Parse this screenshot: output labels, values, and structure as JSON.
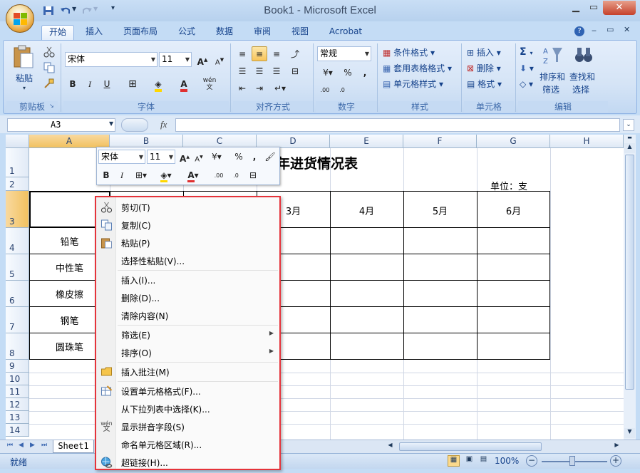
{
  "window": {
    "title": "Book1 - Microsoft Excel"
  },
  "tabs": [
    "开始",
    "插入",
    "页面布局",
    "公式",
    "数据",
    "审阅",
    "视图",
    "Acrobat"
  ],
  "ribbon": {
    "clipboard": {
      "paste": "粘贴",
      "label": "剪贴板"
    },
    "font": {
      "name": "宋体",
      "size": "11",
      "label": "字体",
      "bold": "B",
      "italic": "I",
      "underline": "U",
      "phonetic": "wén"
    },
    "alignment": {
      "label": "对齐方式"
    },
    "number": {
      "format": "常规",
      "percent": "%",
      "comma": ",",
      "label": "数字"
    },
    "styles": {
      "conditional": "条件格式",
      "table": "套用表格格式",
      "cell": "单元格样式",
      "label": "样式"
    },
    "cells": {
      "insert": "插入",
      "delete": "删除",
      "format": "格式",
      "label": "单元格"
    },
    "editing": {
      "sigma": "Σ",
      "sort": "排序和",
      "sort2": "筛选",
      "find": "查找和",
      "find2": "选择",
      "label": "编辑"
    }
  },
  "formula_bar": {
    "name_box": "A3",
    "fx": "fx",
    "value": ""
  },
  "columns": [
    "A",
    "B",
    "C",
    "D",
    "E",
    "F",
    "G",
    "H"
  ],
  "rows": [
    "1",
    "2",
    "3",
    "4",
    "5",
    "6",
    "7",
    "8",
    "9",
    "10",
    "11",
    "12",
    "13",
    "14"
  ],
  "sheet": {
    "title": "年进货情况表",
    "unit": "单位：支",
    "months": [
      "3月",
      "4月",
      "5月",
      "6月"
    ],
    "items": [
      "铅笔",
      "中性笔",
      "橡皮擦",
      "钢笔",
      "圆珠笔"
    ]
  },
  "mini_toolbar": {
    "font": "宋体",
    "size": "11",
    "percent": "%",
    "comma": ","
  },
  "context_menu": [
    {
      "label": "剪切(T)",
      "icon": "scissors-icon"
    },
    {
      "label": "复制(C)",
      "icon": "copy-icon"
    },
    {
      "label": "粘贴(P)",
      "icon": "paste-icon"
    },
    {
      "label": "选择性粘贴(V)...",
      "icon": ""
    },
    {
      "label": "插入(I)...",
      "icon": ""
    },
    {
      "label": "删除(D)...",
      "icon": ""
    },
    {
      "label": "清除内容(N)",
      "icon": ""
    },
    {
      "label": "筛选(E)",
      "icon": "",
      "submenu": true
    },
    {
      "label": "排序(O)",
      "icon": "",
      "submenu": true
    },
    {
      "label": "插入批注(M)",
      "icon": "comment-icon"
    },
    {
      "label": "设置单元格格式(F)...",
      "icon": "format-cells-icon"
    },
    {
      "label": "从下拉列表中选择(K)...",
      "icon": ""
    },
    {
      "label": "显示拼音字段(S)",
      "icon": "phonetic-icon"
    },
    {
      "label": "命名单元格区域(R)...",
      "icon": ""
    },
    {
      "label": "超链接(H)...",
      "icon": "hyperlink-icon"
    }
  ],
  "sheet_tabs": [
    "Sheet1"
  ],
  "status": {
    "ready": "就绪",
    "zoom": "100%"
  },
  "colors": {
    "accent": "#e5333a",
    "ribbon": "#d5e4f6"
  }
}
